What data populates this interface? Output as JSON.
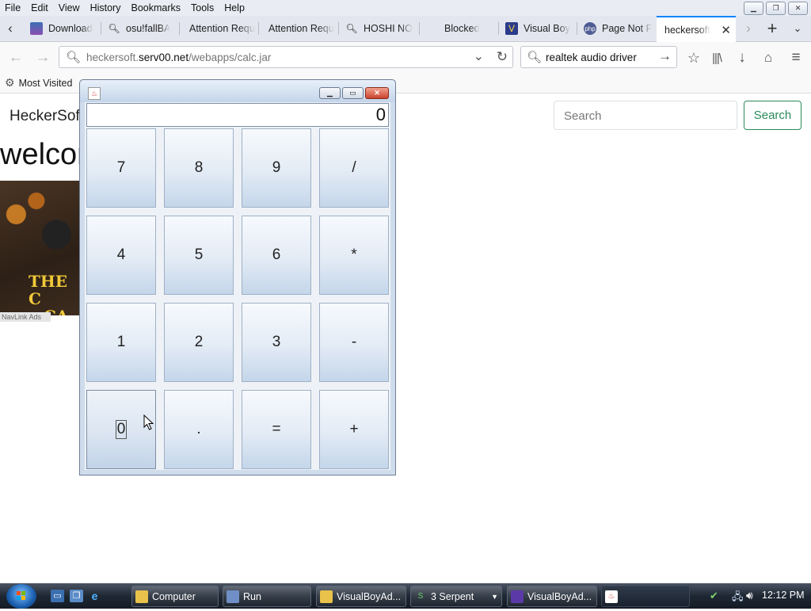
{
  "menu": [
    "File",
    "Edit",
    "View",
    "History",
    "Bookmarks",
    "Tools",
    "Help"
  ],
  "tabs": [
    {
      "label": "Download",
      "icon": "page-icon"
    },
    {
      "label": "osu!fallBA",
      "icon": "search-icon"
    },
    {
      "label": "Attention Requ",
      "icon": "none"
    },
    {
      "label": "Attention Requ",
      "icon": "none"
    },
    {
      "label": "HOSHI NO",
      "icon": "search-icon"
    },
    {
      "label": "Blocked",
      "icon": "none"
    },
    {
      "label": "Visual Boy",
      "icon": "vba-icon"
    },
    {
      "label": "Page Not F",
      "icon": "php-icon"
    },
    {
      "label": "heckersoft",
      "icon": "none",
      "active": true
    }
  ],
  "nav": {
    "url_domain_prefix": "heckersoft.",
    "url_domain": "serv00.net",
    "url_path": "/webapps/calc.jar",
    "search_value": "realtek audio driver"
  },
  "bookmarks": {
    "most_visited": "Most Visited"
  },
  "page": {
    "site_name": "HeckerSof",
    "search_placeholder": "Search",
    "search_button": "Search",
    "welcome": "welcor",
    "ad_text_line1": "THE C",
    "ad_text_line2": ".CA",
    "ad_link": "NavLink Ads"
  },
  "calculator": {
    "display": "0",
    "keys": [
      [
        "7",
        "8",
        "9",
        "/"
      ],
      [
        "4",
        "5",
        "6",
        "*"
      ],
      [
        "1",
        "2",
        "3",
        "-"
      ],
      [
        "0",
        ".",
        "=",
        "+"
      ]
    ]
  },
  "taskbar": {
    "buttons": [
      {
        "label": "Computer",
        "icon": "folder-icon"
      },
      {
        "label": "Run",
        "icon": "run-icon"
      },
      {
        "label": "VisualBoyAd...",
        "icon": "folder-icon"
      },
      {
        "label": "3 Serpent",
        "icon": "serpent-icon"
      },
      {
        "label": "VisualBoyAd...",
        "icon": "vba-icon"
      },
      {
        "label": "",
        "icon": "java-icon",
        "active": true
      }
    ],
    "clock": "12:12 PM"
  }
}
